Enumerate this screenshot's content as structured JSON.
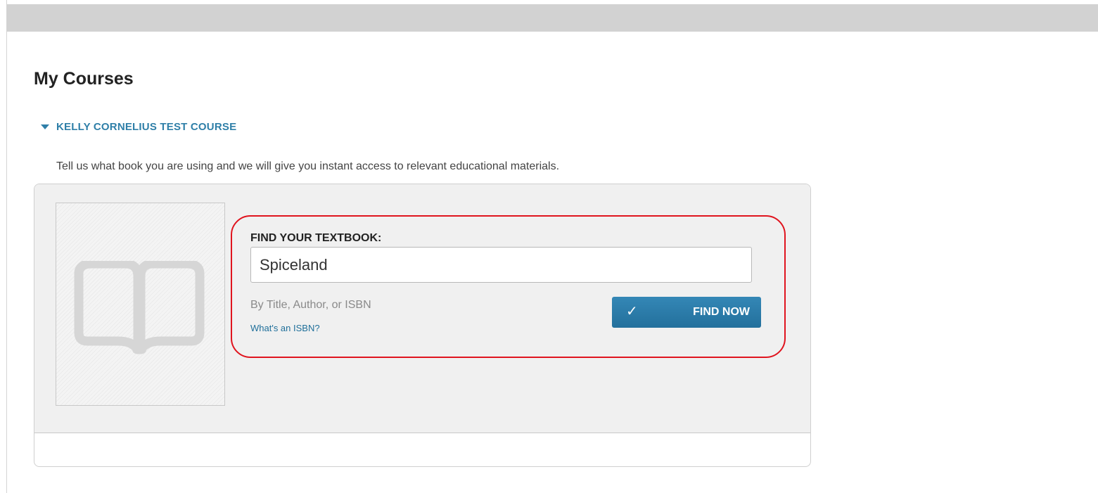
{
  "page": {
    "title": "My Courses"
  },
  "course": {
    "name": "KELLY CORNELIUS TEST COURSE",
    "intro": "Tell us what book you are using and we will give you instant access to relevant educational materials."
  },
  "finder": {
    "label": "FIND YOUR TEXTBOOK:",
    "input_value": "Spiceland",
    "hint": "By Title, Author, or ISBN",
    "isbn_link": "What's an ISBN?",
    "button_label": "FIND NOW",
    "button_icon": "check-icon"
  },
  "icons": {
    "collapse": "caret-down-icon",
    "placeholder_book": "open-book-icon"
  },
  "colors": {
    "accent": "#2f7fa8",
    "button": "#2a7aa7",
    "highlight": "#e0141e"
  }
}
